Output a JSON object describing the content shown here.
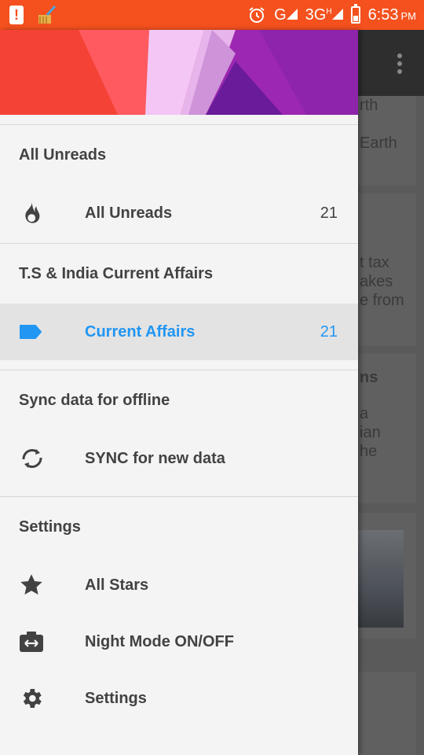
{
  "statusbar": {
    "network": "G",
    "network2": "3G",
    "network2_sup": "H",
    "time": "6:53",
    "ampm": "PM"
  },
  "drawer": {
    "sections": [
      {
        "title": "All Unreads",
        "items": [
          {
            "label": "All Unreads",
            "count": "21",
            "icon": "fire-icon"
          }
        ]
      },
      {
        "title": "T.S & India Current Affairs",
        "items": [
          {
            "label": "Current Affairs",
            "count": "21",
            "icon": "label-tag-icon",
            "active": true
          }
        ]
      },
      {
        "title": "Sync data for offline",
        "items": [
          {
            "label": "SYNC for new data",
            "icon": "sync-icon"
          }
        ]
      },
      {
        "title": "Settings",
        "items": [
          {
            "label": "All Stars",
            "icon": "star-icon"
          },
          {
            "label": "Night Mode ON/OFF",
            "icon": "night-mode-icon"
          },
          {
            "label": "Settings",
            "icon": "gear-icon"
          }
        ]
      }
    ]
  },
  "background_cards": {
    "card1": [
      "rth",
      "Earth"
    ],
    "card2": [
      "t tax",
      "akes",
      "e from"
    ],
    "card3_title": "ns",
    "card3": [
      "a",
      "ian",
      "he"
    ]
  },
  "colors": {
    "statusbar": "#f4511e",
    "accent": "#2196f3",
    "drawer_bg": "#f4f4f4",
    "text": "#424242"
  }
}
